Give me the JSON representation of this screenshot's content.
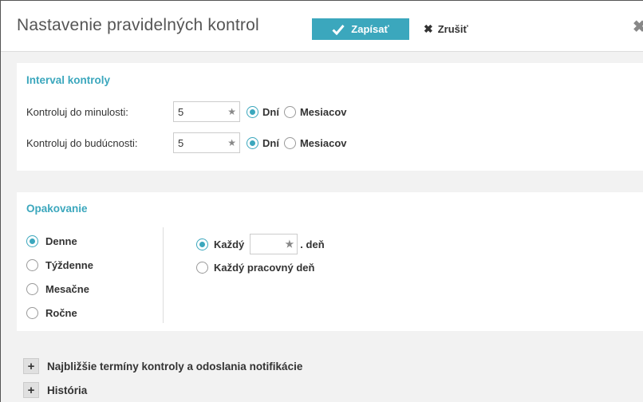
{
  "header": {
    "title": "Nastavenie pravidelných kontrol",
    "save_label": "Zapísať",
    "cancel_label": "Zrušiť",
    "close_glyph": "✖"
  },
  "interval": {
    "title": "Interval kontroly",
    "past": {
      "label": "Kontroluj do minulosti:",
      "value": "5",
      "unit_selected": "Dní",
      "options": [
        "Dní",
        "Mesiacov"
      ]
    },
    "future": {
      "label": "Kontroluj do budúcnosti:",
      "value": "5",
      "unit_selected": "Dní",
      "options": [
        "Dní",
        "Mesiacov"
      ]
    }
  },
  "repeat": {
    "title": "Opakovanie",
    "frequencies": [
      "Denne",
      "Týždenne",
      "Mesačne",
      "Ročne"
    ],
    "selected_frequency": "Denne",
    "every_label": "Každý",
    "every_value": "",
    "every_suffix": ". deň",
    "every_workday_label": "Každý pracovný deň",
    "selected_daily_mode": "Každý"
  },
  "sections": {
    "next_terms": "Najbližšie termíny kontroly a odoslania notifikácie",
    "history": "História",
    "plus_glyph": "+"
  },
  "colors": {
    "accent": "#3ba7bd"
  }
}
